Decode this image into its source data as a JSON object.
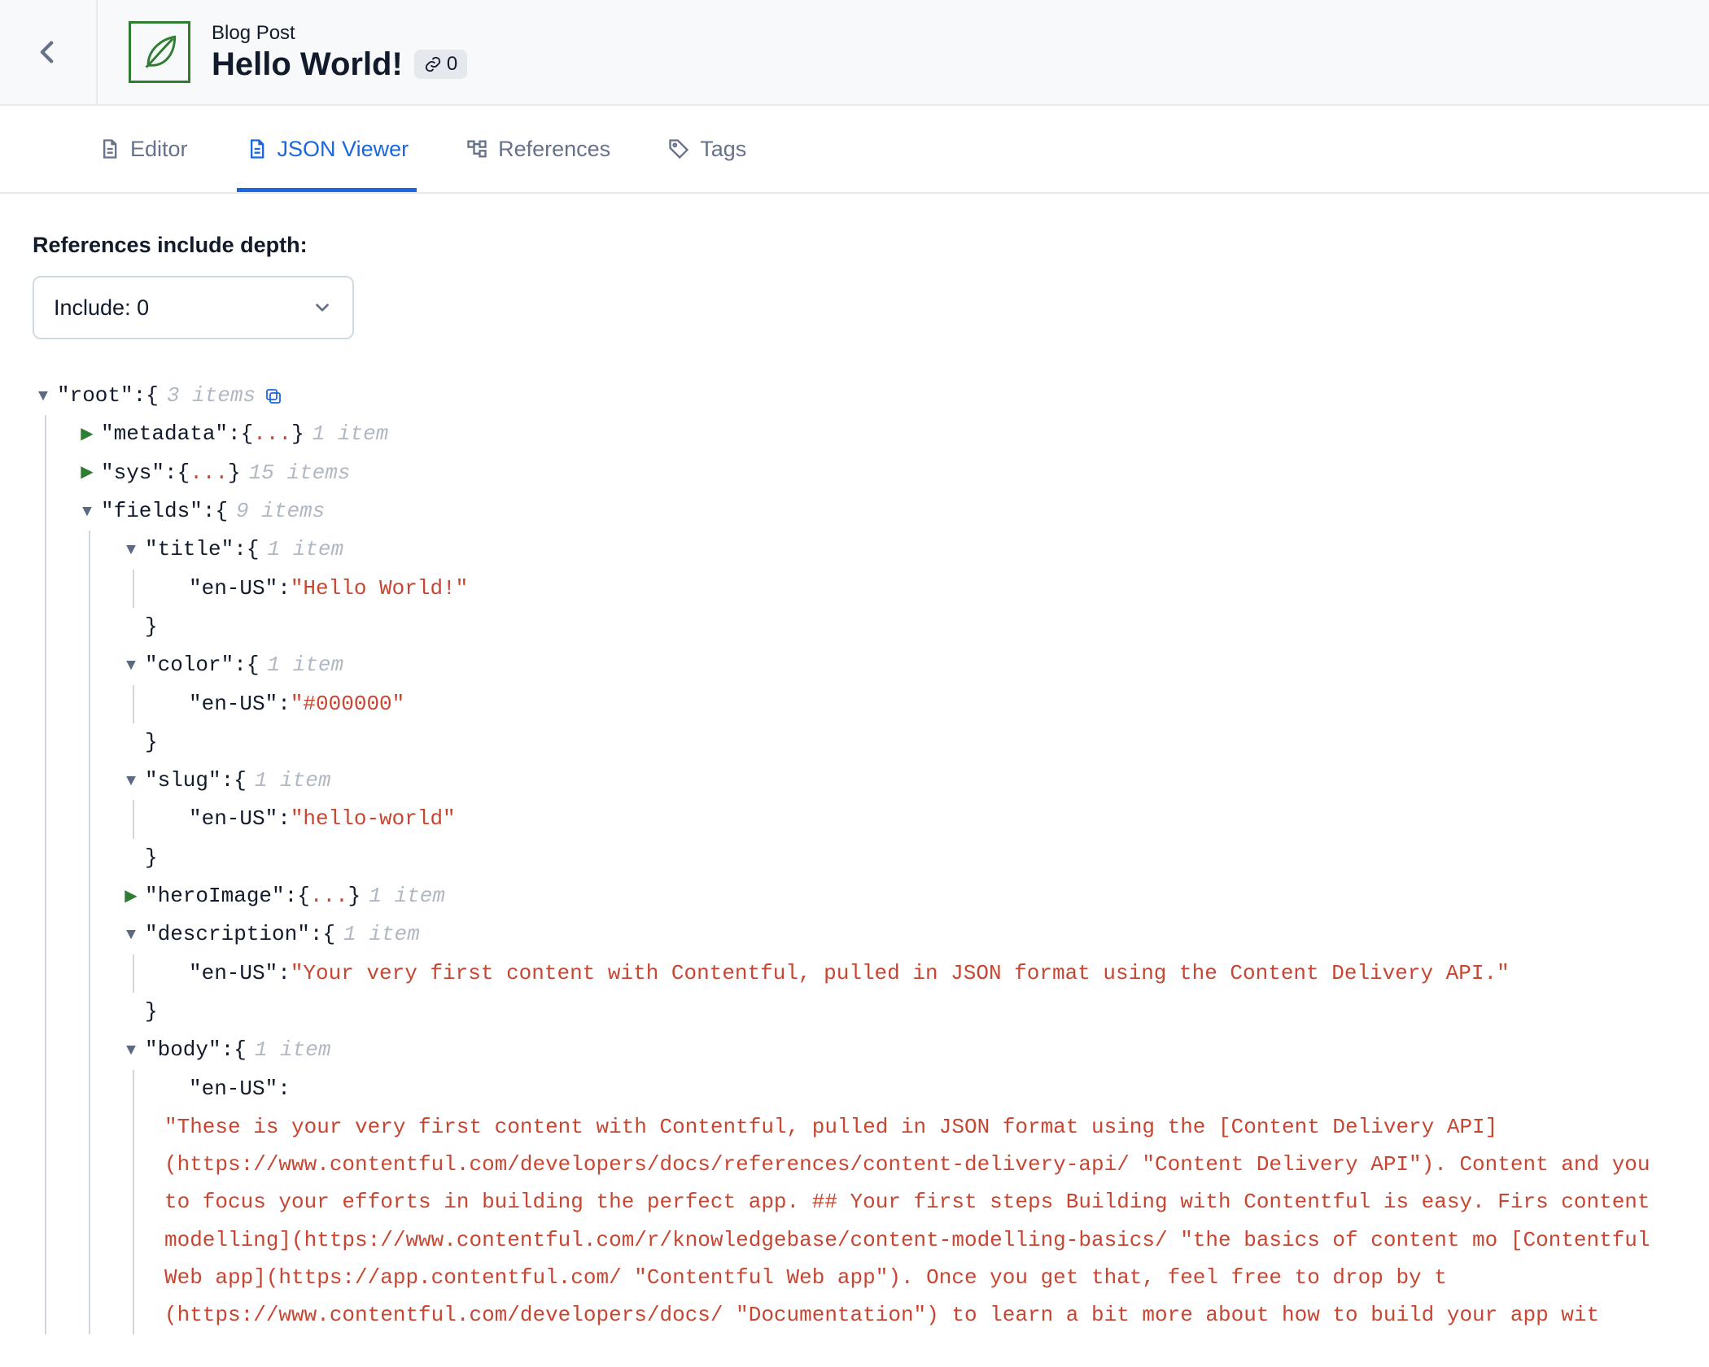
{
  "header": {
    "content_type_label": "Blog Post",
    "title": "Hello World!",
    "link_count": "0"
  },
  "tabs": {
    "editor": "Editor",
    "json_viewer": "JSON Viewer",
    "references": "References",
    "tags": "Tags"
  },
  "depth": {
    "label": "References include depth:",
    "value": "Include: 0"
  },
  "json": {
    "root_key": "\"root\"",
    "root_meta": "3 items",
    "metadata_key": "\"metadata\"",
    "metadata_meta": "1 item",
    "sys_key": "\"sys\"",
    "sys_meta": "15 items",
    "fields_key": "\"fields\"",
    "fields_meta": "9 items",
    "title_key": "\"title\"",
    "title_meta": "1 item",
    "title_locale": "\"en-US\"",
    "title_value": "\"Hello World!\"",
    "color_key": "\"color\"",
    "color_meta": "1 item",
    "color_locale": "\"en-US\"",
    "color_value": "\"#000000\"",
    "slug_key": "\"slug\"",
    "slug_meta": "1 item",
    "slug_locale": "\"en-US\"",
    "slug_value": "\"hello-world\"",
    "heroImage_key": "\"heroImage\"",
    "heroImage_meta": "1 item",
    "description_key": "\"description\"",
    "description_meta": "1 item",
    "description_locale": "\"en-US\"",
    "description_value": "\"Your very first content with Contentful, pulled in JSON format using the Content Delivery API.\"",
    "body_key": "\"body\"",
    "body_meta": "1 item",
    "body_locale": "\"en-US\"",
    "body_value": "\"These is your very first content with Contentful, pulled in JSON format using the [Content Delivery API](https://www.contentful.com/developers/docs/references/content-delivery-api/ \"Content Delivery API\"). Content and you to focus your efforts in building the perfect app. ## Your first steps Building with Contentful is easy. Firs content modelling](https://www.contentful.com/r/knowledgebase/content-modelling-basics/ \"the basics of content mo [Contentful Web app](https://app.contentful.com/ \"Contentful Web app\"). Once you get that, feel free to drop by t (https://www.contentful.com/developers/docs/ \"Documentation\") to learn a bit more about how to build your app wit",
    "ellipsis": "...",
    "open_brace": "{",
    "close_brace": "}",
    "colon": " : "
  }
}
